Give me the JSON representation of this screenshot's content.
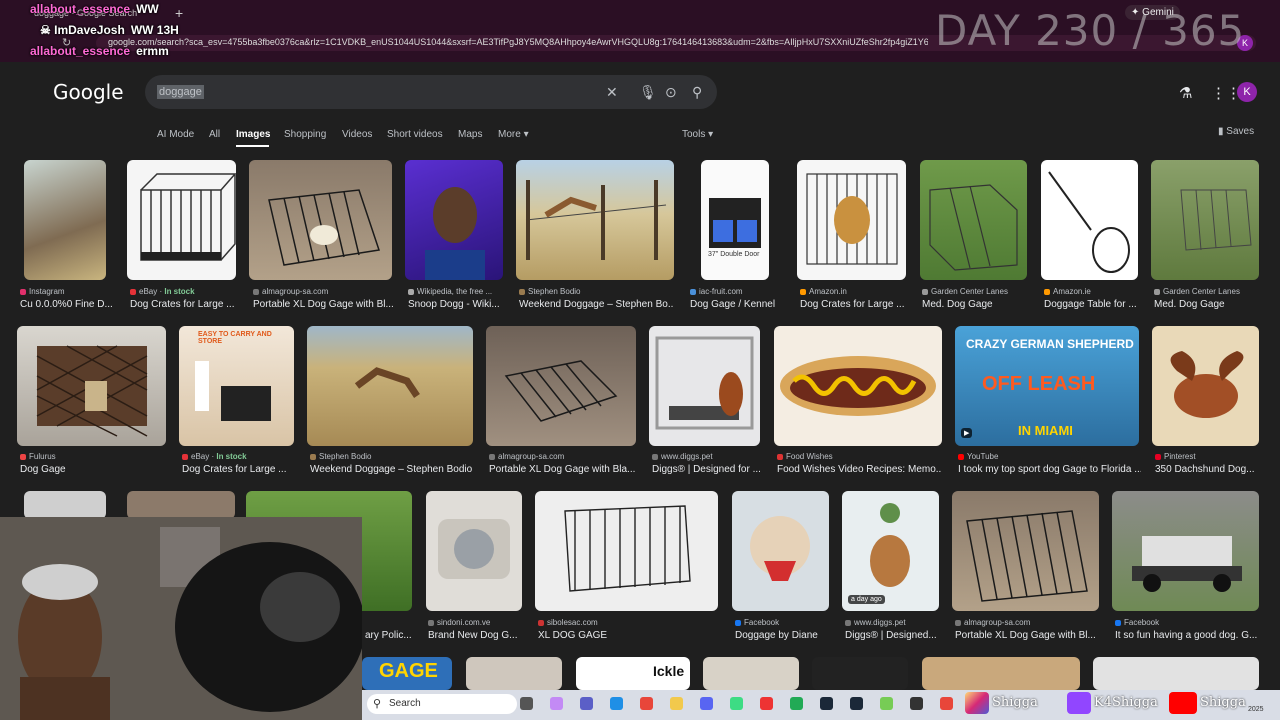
{
  "browser": {
    "tab_title": "doggage - Google Search",
    "new_tab": "+",
    "url": "google.com/search?sca_esv=4755ba3fbe0376ca&rlz=1C1VDKB_enUS1044US1044&sxsrf=AE3TifPgJ8Y5MQ8AHhpoy4eAwrVHGQLU8g:1764146413683&udm=2&fbs=AIljpHxU7SXXniUZfeShr2fp4giZ1Y6MJ25_tmWITc7uy4Klelovp3FuhN1Y",
    "gemini_label": "Gemini",
    "profile_initial": "K"
  },
  "overlay": {
    "chat": [
      {
        "user": "allabout_essence",
        "message": "WW"
      },
      {
        "user": "ImDaveJosh",
        "message": "WW 13H"
      },
      {
        "user": "allabout_essence",
        "message": "ermm"
      }
    ],
    "day_counter": "DAY 230 / 365"
  },
  "google": {
    "logo": "Google",
    "query": "doggage",
    "tabs": [
      "AI Mode",
      "All",
      "Images",
      "Shopping",
      "Videos",
      "Short videos",
      "Maps",
      "More"
    ],
    "tools": "Tools",
    "saves": "Saves",
    "avatar_initial": "K"
  },
  "results": {
    "row1": [
      {
        "source": "Instagram",
        "title": "Cu 0.0.0%0 Fine D..."
      },
      {
        "source": "eBay",
        "stock": "In stock",
        "title": "Dog Crates for Large ..."
      },
      {
        "source": "almagroup-sa.com",
        "title": "Portable XL Dog Gage with Bl..."
      },
      {
        "source": "Wikipedia, the free ...",
        "title": "Snoop Dogg - Wiki..."
      },
      {
        "source": "Stephen Bodio",
        "title": "Weekend Doggage – Stephen Bo..."
      },
      {
        "source": "iac-fruit.com",
        "title": "Dog Gage / Kennel"
      },
      {
        "source": "Amazon.in",
        "title": "Dog Crates for Large ..."
      },
      {
        "source": "Garden Center Lanes",
        "title": "Med. Dog Gage"
      },
      {
        "source": "Amazon.ie",
        "title": "Doggage Table for ..."
      },
      {
        "source": "Garden Center Lanes",
        "title": "Med. Dog Gage"
      }
    ],
    "row2": [
      {
        "source": "Fulurus",
        "title": "Dog Gage"
      },
      {
        "source": "eBay",
        "stock": "In stock",
        "title": "Dog Crates for Large ..."
      },
      {
        "source": "Stephen Bodio",
        "title": "Weekend Doggage – Stephen Bodio"
      },
      {
        "source": "almagroup-sa.com",
        "title": "Portable XL Dog Gage with Bla..."
      },
      {
        "source": "www.diggs.pet",
        "title": "Diggs® | Designed for ..."
      },
      {
        "source": "Food Wishes",
        "title": "Food Wishes Video Recipes: Memo..."
      },
      {
        "source": "YouTube",
        "title": "I took my top sport dog Gage to Florida ..."
      },
      {
        "source": "Pinterest",
        "title": "350 Dachshund Dog..."
      }
    ],
    "row3": [
      {
        "source": "",
        "title": "ary Polic..."
      },
      {
        "source": "sindoni.com.ve",
        "title": "Brand New Dog G..."
      },
      {
        "source": "sibolesac.com",
        "title": "XL DOG GAGE"
      },
      {
        "source": "Facebook",
        "title": "Doggage by Diane"
      },
      {
        "source": "www.diggs.pet",
        "title": "Diggs® | Designed..."
      },
      {
        "source": "almagroup-sa.com",
        "title": "Portable XL Dog Gage with Bl..."
      },
      {
        "source": "Facebook",
        "title": "It so fun having a good dog. G..."
      }
    ],
    "badges": {
      "double_door": "37\" Double Door",
      "day_ago": "a day ago",
      "crazy_german": "CRAZY GERMAN SHEPHERD",
      "off_leash": "OFF LEASH",
      "in_miami": "IN MIAMI",
      "easy_carry": "EASY TO CARRY AND STORE",
      "gage_sign": "GAGE",
      "ickle": "Ickle"
    }
  },
  "taskbar": {
    "search_placeholder": "Search",
    "social": [
      "Shigga",
      "K4Shigga",
      "Shigga"
    ],
    "clock": "2025"
  },
  "colors": {
    "chat_user": "#ff6ad5",
    "chrome_bg": "#2b0f24",
    "page_bg": "#1f1f1f",
    "stock_green": "#81c995"
  }
}
